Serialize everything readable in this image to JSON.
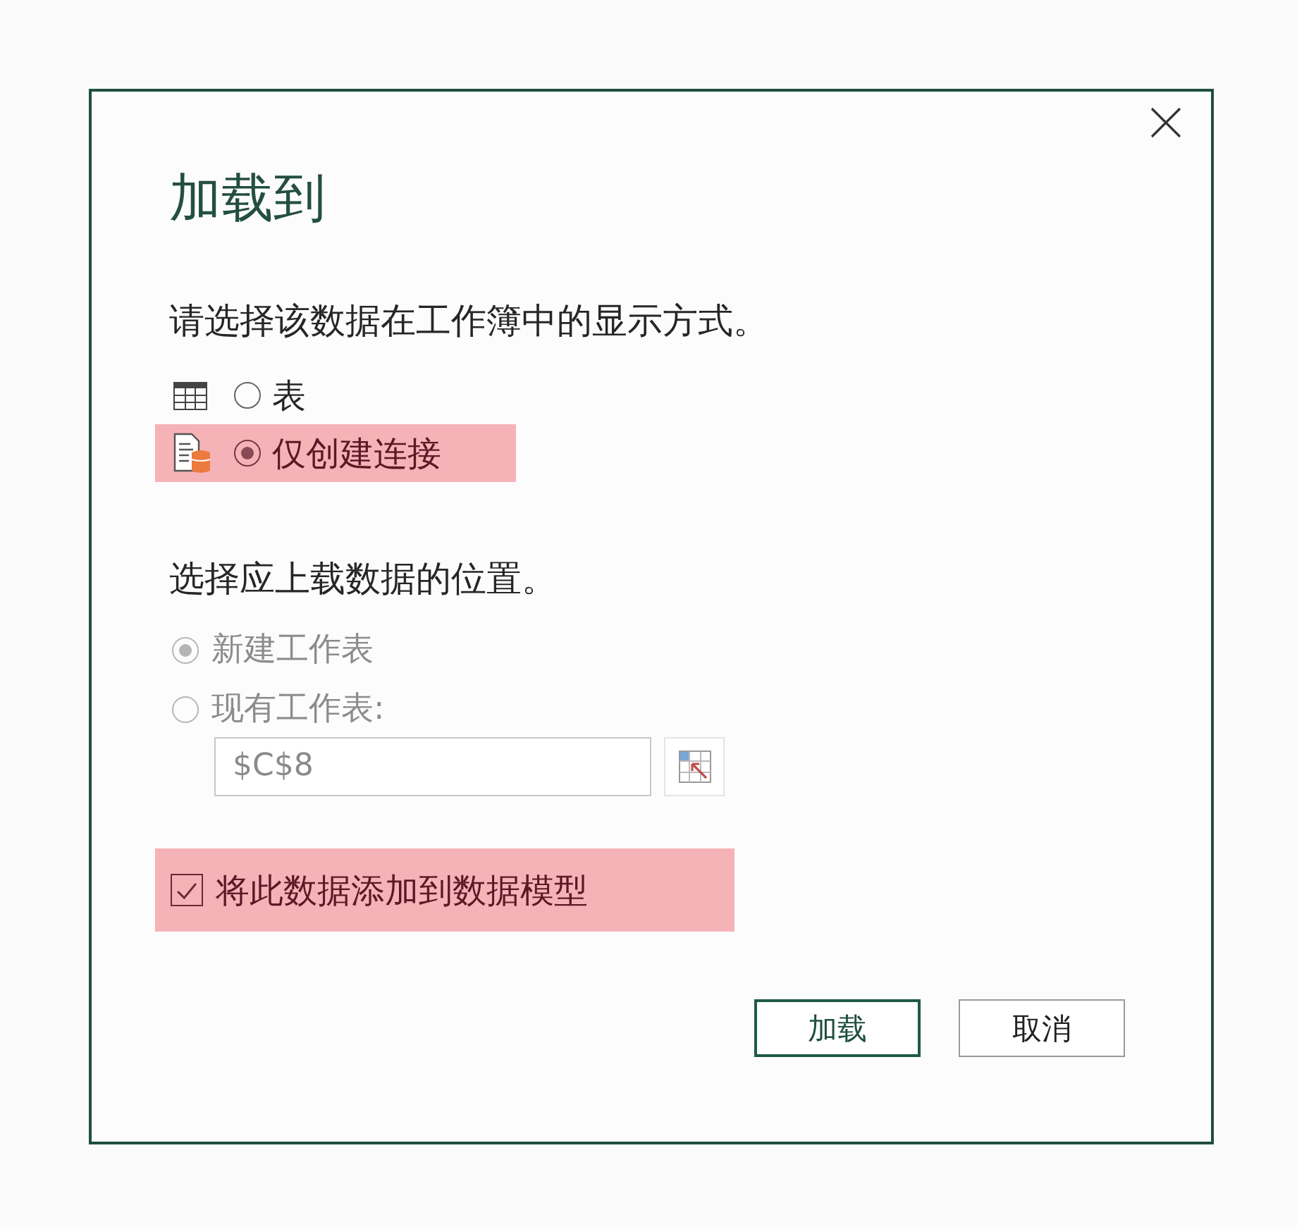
{
  "dialog": {
    "title": "加载到"
  },
  "display_section": {
    "prompt": "请选择该数据在工作簿中的显示方式。",
    "options": [
      {
        "kind": "table",
        "label": "表",
        "selected": false,
        "highlighted": false
      },
      {
        "kind": "connection",
        "label": "仅创建连接",
        "selected": true,
        "highlighted": true
      }
    ]
  },
  "location_section": {
    "prompt": "选择应上载数据的位置。",
    "disabled": true,
    "options": [
      {
        "label": "新建工作表",
        "selected": true
      },
      {
        "label": "现有工作表:",
        "selected": false
      }
    ],
    "reference": {
      "value": "$C$8"
    }
  },
  "data_model": {
    "label": "将此数据添加到数据模型",
    "checked": true,
    "highlighted": true
  },
  "buttons": [
    {
      "label": "加载",
      "kind": "primary"
    },
    {
      "label": "取消",
      "kind": "secondary"
    }
  ]
}
